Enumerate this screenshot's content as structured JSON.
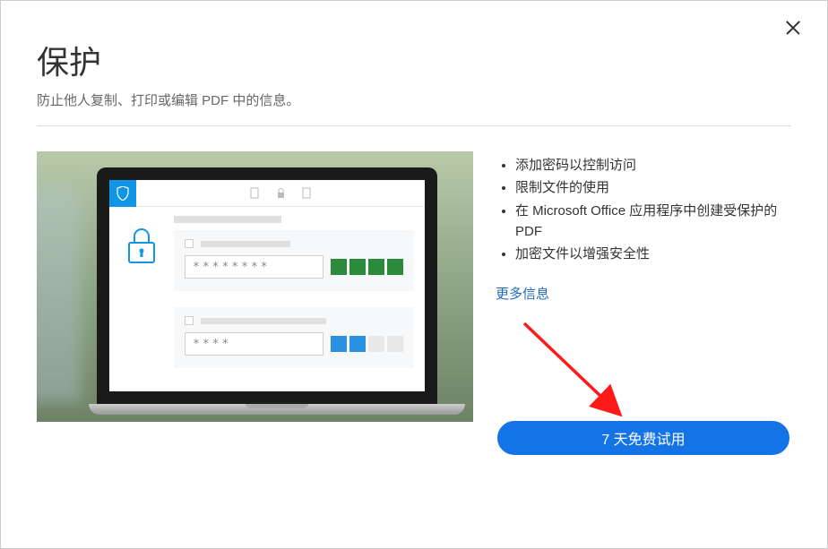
{
  "header": {
    "title": "保护",
    "subtitle": "防止他人复制、打印或编辑 PDF 中的信息。"
  },
  "features": {
    "items": [
      "添加密码以控制访问",
      "限制文件的使用",
      "在 Microsoft Office 应用程序中创建受保护的 PDF",
      "加密文件以增强安全性"
    ],
    "more_info": "更多信息"
  },
  "cta": {
    "label": "7 天免费试用"
  },
  "illustration": {
    "password1": "********",
    "password2": "****"
  }
}
